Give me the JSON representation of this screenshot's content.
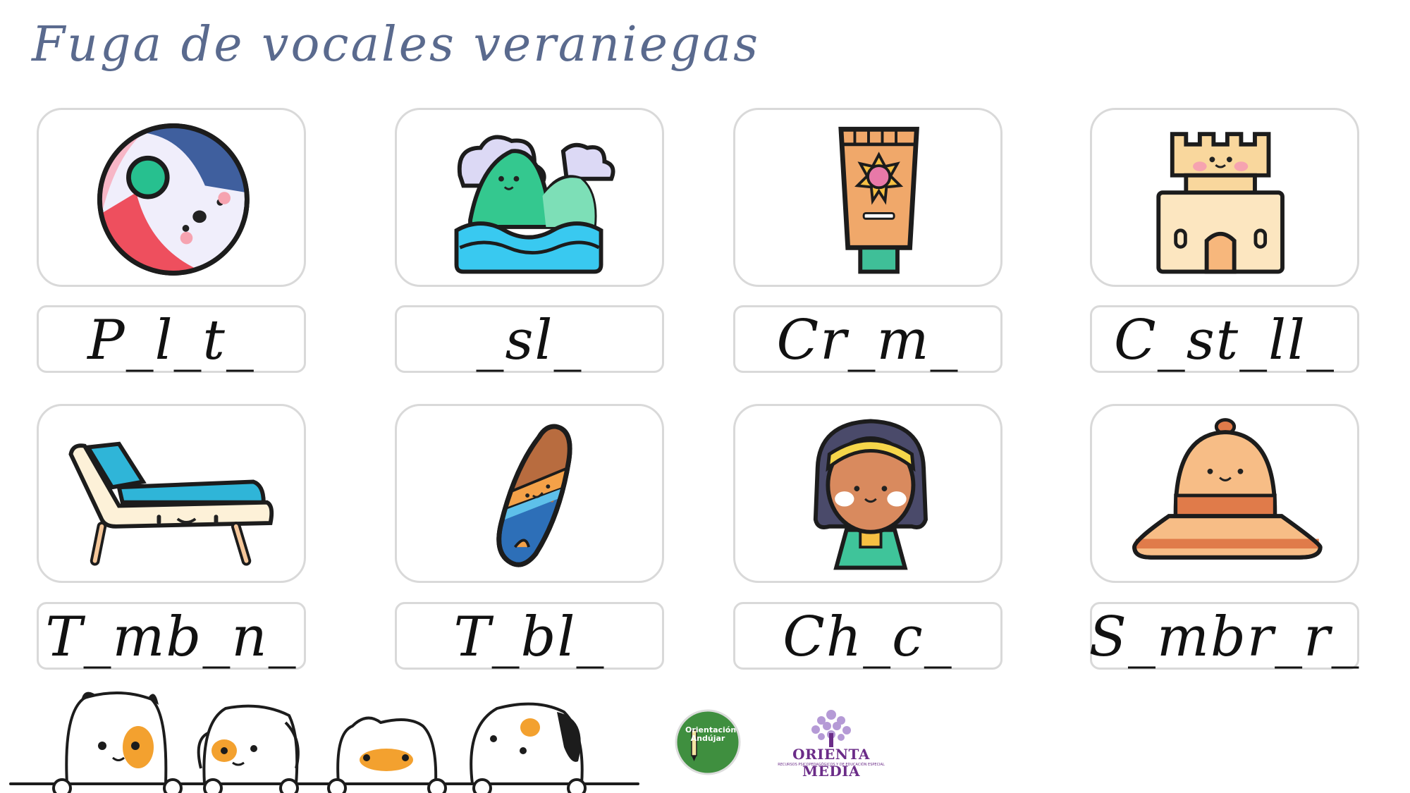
{
  "title": "Fuga de vocales veraniegas",
  "cards": [
    {
      "icon": "beach-ball-icon",
      "word": "P_l_t_"
    },
    {
      "icon": "island-icon",
      "word": "_sl_"
    },
    {
      "icon": "sunscreen-icon",
      "word": "Cr_m_"
    },
    {
      "icon": "sandcastle-icon",
      "word": "C_st_ll_"
    },
    {
      "icon": "sun-lounger-icon",
      "word": "T_mb_n_"
    },
    {
      "icon": "surfboard-icon",
      "word": "T_bl_"
    },
    {
      "icon": "girl-icon",
      "word": "Ch_c_"
    },
    {
      "icon": "sun-hat-icon",
      "word": "S_mbr_r_"
    }
  ],
  "logos": {
    "left_text": "Orientación Andújar",
    "right_text": "ORIENTA MEDIA",
    "right_sub": "RECURSOS PSICOPEDAGÓGICOS Y DE EDUCACIÓN ESPECIAL"
  }
}
